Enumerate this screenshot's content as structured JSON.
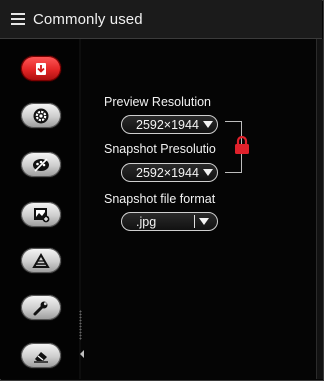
{
  "header": {
    "title": "Commonly used",
    "menu_icon": "hamburger-menu-icon"
  },
  "sidebar": {
    "items": [
      {
        "name": "download-settings",
        "icon": "download-icon",
        "active": true
      },
      {
        "name": "capture-settings",
        "icon": "gear-circle-icon",
        "active": false
      },
      {
        "name": "color-settings",
        "icon": "palette-icon",
        "active": false
      },
      {
        "name": "image-settings",
        "icon": "image-add-icon",
        "active": false
      },
      {
        "name": "tools",
        "icon": "ruler-triangle-icon",
        "active": false
      },
      {
        "name": "settings",
        "icon": "wrench-icon",
        "active": false
      },
      {
        "name": "erase",
        "icon": "eraser-icon",
        "active": false
      }
    ]
  },
  "panel": {
    "preview_resolution_label": "Preview Resolution",
    "preview_resolution_value": "2592×1944",
    "snapshot_resolution_label": "Snapshot Presolutio",
    "snapshot_resolution_value": "2592×1944",
    "snapshot_format_label": "Snapshot file format",
    "snapshot_format_value": ".jpg",
    "lock_icon": "lock-icon"
  },
  "colors": {
    "active": "#e32626",
    "lock": "#e0212b",
    "background": "#000000"
  }
}
